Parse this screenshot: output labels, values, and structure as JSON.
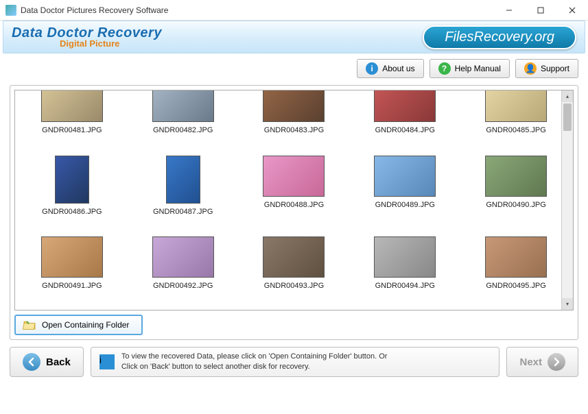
{
  "titlebar": {
    "title": "Data Doctor Pictures Recovery Software"
  },
  "banner": {
    "main": "Data Doctor Recovery",
    "sub": "Digital Picture",
    "site": "FilesRecovery.org"
  },
  "info_buttons": {
    "about": "About us",
    "help": "Help Manual",
    "support": "Support"
  },
  "thumbs": [
    {
      "label": "GNDR00481.JPG",
      "cls": "g1",
      "shape": "land",
      "cut": true
    },
    {
      "label": "GNDR00482.JPG",
      "cls": "g2",
      "shape": "land",
      "cut": true
    },
    {
      "label": "GNDR00483.JPG",
      "cls": "g3",
      "shape": "land",
      "cut": true
    },
    {
      "label": "GNDR00484.JPG",
      "cls": "g4",
      "shape": "land",
      "cut": true
    },
    {
      "label": "GNDR00485.JPG",
      "cls": "g5",
      "shape": "land",
      "cut": true
    },
    {
      "label": "GNDR00486.JPG",
      "cls": "g6",
      "shape": "portrait"
    },
    {
      "label": "GNDR00487.JPG",
      "cls": "g7",
      "shape": "portrait"
    },
    {
      "label": "GNDR00488.JPG",
      "cls": "g8",
      "shape": "land"
    },
    {
      "label": "GNDR00489.JPG",
      "cls": "g9",
      "shape": "land"
    },
    {
      "label": "GNDR00490.JPG",
      "cls": "g10",
      "shape": "land"
    },
    {
      "label": "GNDR00491.JPG",
      "cls": "g11",
      "shape": "land"
    },
    {
      "label": "GNDR00492.JPG",
      "cls": "g12",
      "shape": "land"
    },
    {
      "label": "GNDR00493.JPG",
      "cls": "g13",
      "shape": "land"
    },
    {
      "label": "GNDR00494.JPG",
      "cls": "g14",
      "shape": "land"
    },
    {
      "label": "GNDR00495.JPG",
      "cls": "g15",
      "shape": "land"
    }
  ],
  "open_folder": "Open Containing Folder",
  "footer": {
    "back": "Back",
    "next": "Next",
    "hint1": "To view the recovered Data, please click on 'Open Containing Folder' button. Or",
    "hint2": "Click on 'Back' button to select another disk for recovery."
  }
}
